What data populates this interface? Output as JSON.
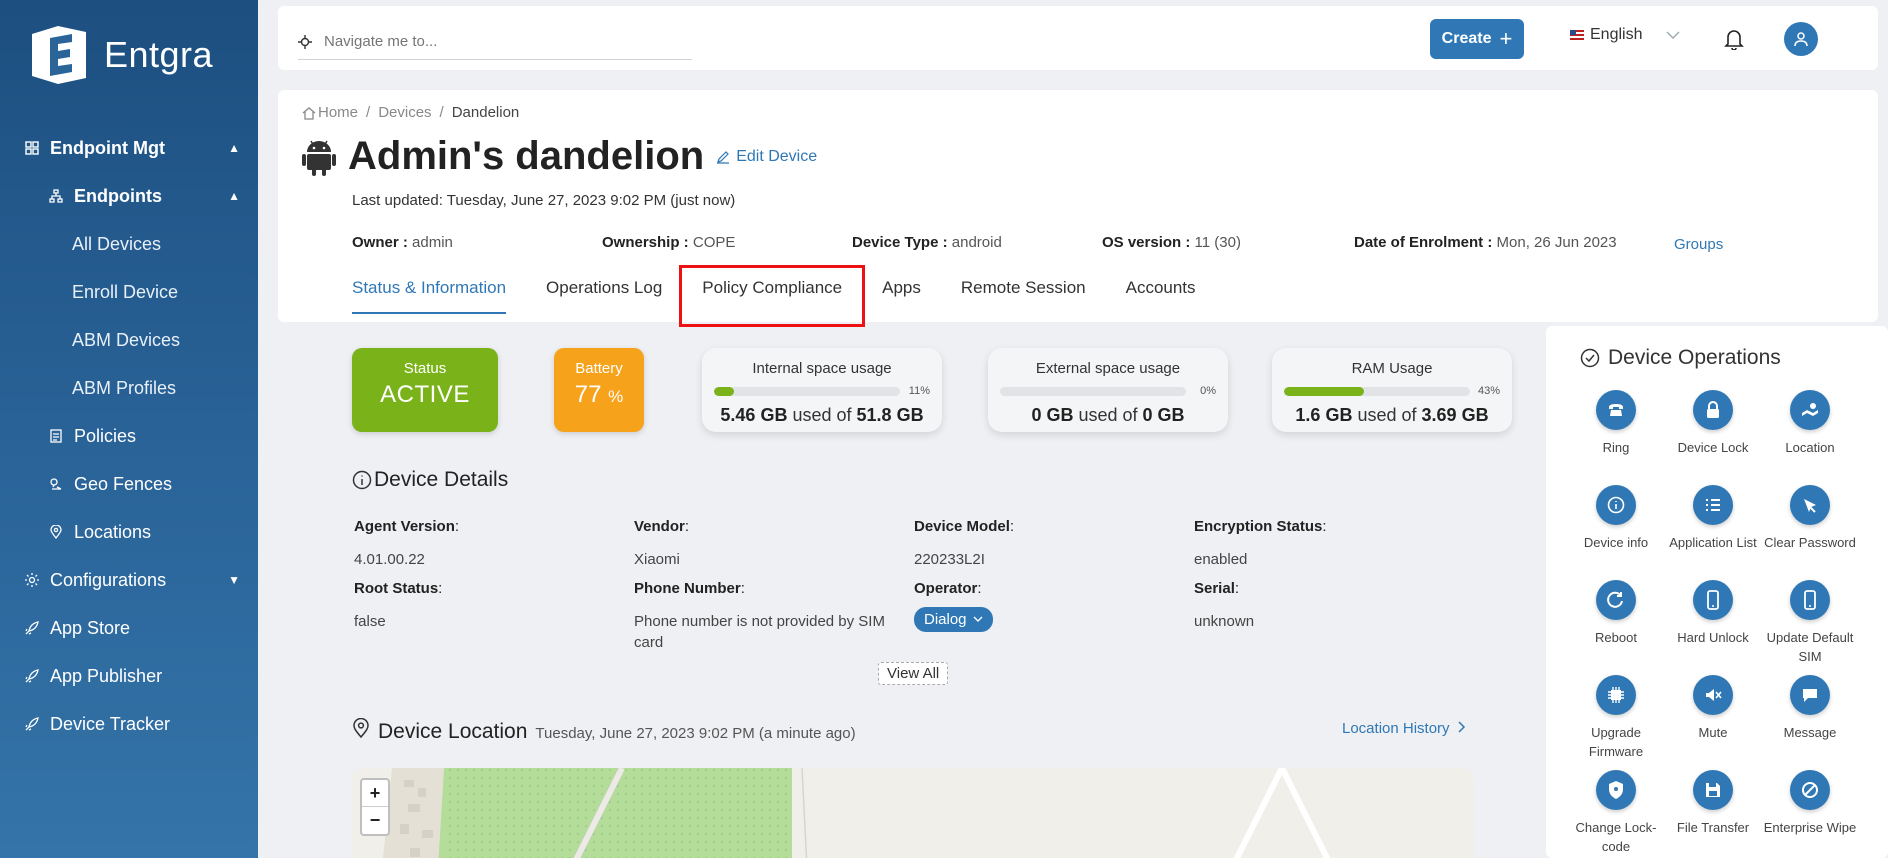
{
  "app": {
    "brand": "Entgra"
  },
  "sidebar": {
    "items": [
      {
        "label": "Endpoint Mgt",
        "icon": "grid-icon"
      },
      {
        "label": "Endpoints",
        "icon": "hierarchy-icon"
      },
      {
        "label": "All Devices"
      },
      {
        "label": "Enroll Device"
      },
      {
        "label": "ABM Devices"
      },
      {
        "label": "ABM Profiles"
      },
      {
        "label": "Policies",
        "icon": "document-icon"
      },
      {
        "label": "Geo Fences",
        "icon": "geofence-icon"
      },
      {
        "label": "Locations",
        "icon": "location-pin-icon"
      },
      {
        "label": "Configurations",
        "icon": "gear-icon"
      },
      {
        "label": "App Store",
        "icon": "rocket-icon"
      },
      {
        "label": "App Publisher",
        "icon": "rocket-icon"
      },
      {
        "label": "Device Tracker",
        "icon": "rocket-icon"
      }
    ]
  },
  "topbar": {
    "search_placeholder": "Navigate me to...",
    "create_label": "Create",
    "language": "English"
  },
  "breadcrumb": {
    "home": "Home",
    "devices": "Devices",
    "current": "Dandelion",
    "sep": "/"
  },
  "device": {
    "title": "Admin's dandelion",
    "edit_label": "Edit Device",
    "last_updated": "Last updated: Tuesday, June 27, 2023 9:02 PM (just now)",
    "owner_label": "Owner :",
    "owner": "admin",
    "ownership_label": "Ownership :",
    "ownership": "COPE",
    "type_label": "Device Type :",
    "type": "android",
    "os_label": "OS version :",
    "os": "11 (30)",
    "enrol_label": "Date of Enrolment :",
    "enrol": "Mon, 26 Jun 2023",
    "groups_label": "Groups"
  },
  "tabs": [
    {
      "label": "Status & Information"
    },
    {
      "label": "Operations Log"
    },
    {
      "label": "Policy Compliance"
    },
    {
      "label": "Apps"
    },
    {
      "label": "Remote Session"
    },
    {
      "label": "Accounts"
    }
  ],
  "status": {
    "label": "Status",
    "value": "ACTIVE",
    "color": "#7ab319"
  },
  "battery": {
    "label": "Battery",
    "value": "77",
    "unit": "%",
    "color": "#f7a21b"
  },
  "usage": [
    {
      "label": "Internal space usage",
      "percent": 11,
      "percent_text": "11%",
      "used": "5.46 GB",
      "of": "used of",
      "total": "51.8 GB"
    },
    {
      "label": "External space usage",
      "percent": 0,
      "percent_text": "0%",
      "used": "0 GB",
      "of": "used of",
      "total": "0 GB"
    },
    {
      "label": "RAM Usage",
      "percent": 43,
      "percent_text": "43%",
      "used": "1.6 GB",
      "of": "used of",
      "total": "3.69 GB"
    }
  ],
  "details": {
    "title": "Device Details",
    "fields": [
      {
        "key": "Agent Version",
        "value": "4.01.00.22"
      },
      {
        "key": "Vendor",
        "value": "Xiaomi"
      },
      {
        "key": "Device Model",
        "value": "220233L2I"
      },
      {
        "key": "Encryption Status",
        "value": "enabled"
      },
      {
        "key": "Root Status",
        "value": "false"
      },
      {
        "key": "Phone Number",
        "value": "Phone number is not provided by SIM card"
      },
      {
        "key": "Operator",
        "value": "Dialog"
      },
      {
        "key": "Serial",
        "value": "unknown"
      }
    ],
    "colon": ":",
    "view_all": "View All"
  },
  "location": {
    "title": "Device Location",
    "timestamp": "Tuesday, June 27, 2023 9:02 PM (a minute ago)",
    "history_label": "Location History",
    "zoom_in": "+",
    "zoom_out": "−"
  },
  "operations": {
    "title": "Device Operations",
    "items": [
      {
        "label": "Ring",
        "icon": "phone-icon"
      },
      {
        "label": "Device Lock",
        "icon": "lock-icon"
      },
      {
        "label": "Location",
        "icon": "map-icon"
      },
      {
        "label": "Device info",
        "icon": "info-icon"
      },
      {
        "label": "Application List",
        "icon": "list-icon"
      },
      {
        "label": "Clear Password",
        "icon": "eraser-icon"
      },
      {
        "label": "Reboot",
        "icon": "reboot-icon"
      },
      {
        "label": "Hard Unlock",
        "icon": "mobile-icon"
      },
      {
        "label": "Update Default SIM",
        "icon": "mobile-icon"
      },
      {
        "label": "Upgrade Firmware",
        "icon": "chip-icon"
      },
      {
        "label": "Mute",
        "icon": "mute-icon"
      },
      {
        "label": "Message",
        "icon": "message-icon"
      },
      {
        "label": "Change Lock-code",
        "icon": "shield-icon"
      },
      {
        "label": "File Transfer",
        "icon": "save-icon"
      },
      {
        "label": "Enterprise Wipe",
        "icon": "block-icon"
      }
    ]
  },
  "colors": {
    "sidebar": "#1d4f80",
    "accent": "#2f78b5",
    "highlight": "#e11111"
  }
}
